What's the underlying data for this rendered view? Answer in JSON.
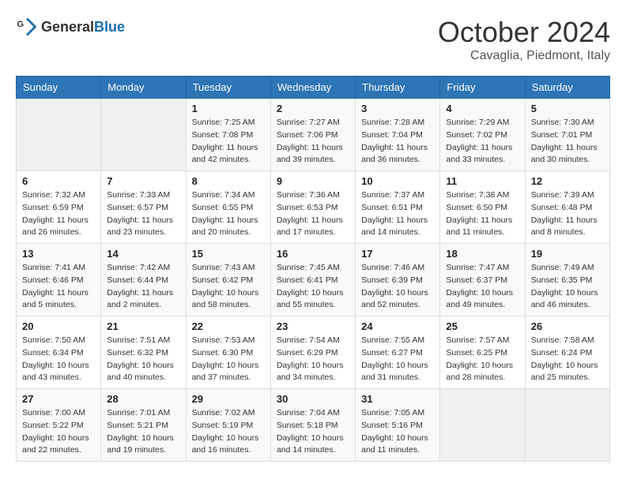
{
  "header": {
    "logo_general": "General",
    "logo_blue": "Blue",
    "title": "October 2024",
    "subtitle": "Cavaglia, Piedmont, Italy"
  },
  "weekdays": [
    "Sunday",
    "Monday",
    "Tuesday",
    "Wednesday",
    "Thursday",
    "Friday",
    "Saturday"
  ],
  "weeks": [
    [
      {
        "day": "",
        "sunrise": "",
        "sunset": "",
        "daylight": ""
      },
      {
        "day": "",
        "sunrise": "",
        "sunset": "",
        "daylight": ""
      },
      {
        "day": "1",
        "sunrise": "Sunrise: 7:25 AM",
        "sunset": "Sunset: 7:08 PM",
        "daylight": "Daylight: 11 hours and 42 minutes."
      },
      {
        "day": "2",
        "sunrise": "Sunrise: 7:27 AM",
        "sunset": "Sunset: 7:06 PM",
        "daylight": "Daylight: 11 hours and 39 minutes."
      },
      {
        "day": "3",
        "sunrise": "Sunrise: 7:28 AM",
        "sunset": "Sunset: 7:04 PM",
        "daylight": "Daylight: 11 hours and 36 minutes."
      },
      {
        "day": "4",
        "sunrise": "Sunrise: 7:29 AM",
        "sunset": "Sunset: 7:02 PM",
        "daylight": "Daylight: 11 hours and 33 minutes."
      },
      {
        "day": "5",
        "sunrise": "Sunrise: 7:30 AM",
        "sunset": "Sunset: 7:01 PM",
        "daylight": "Daylight: 11 hours and 30 minutes."
      }
    ],
    [
      {
        "day": "6",
        "sunrise": "Sunrise: 7:32 AM",
        "sunset": "Sunset: 6:59 PM",
        "daylight": "Daylight: 11 hours and 26 minutes."
      },
      {
        "day": "7",
        "sunrise": "Sunrise: 7:33 AM",
        "sunset": "Sunset: 6:57 PM",
        "daylight": "Daylight: 11 hours and 23 minutes."
      },
      {
        "day": "8",
        "sunrise": "Sunrise: 7:34 AM",
        "sunset": "Sunset: 6:55 PM",
        "daylight": "Daylight: 11 hours and 20 minutes."
      },
      {
        "day": "9",
        "sunrise": "Sunrise: 7:36 AM",
        "sunset": "Sunset: 6:53 PM",
        "daylight": "Daylight: 11 hours and 17 minutes."
      },
      {
        "day": "10",
        "sunrise": "Sunrise: 7:37 AM",
        "sunset": "Sunset: 6:51 PM",
        "daylight": "Daylight: 11 hours and 14 minutes."
      },
      {
        "day": "11",
        "sunrise": "Sunrise: 7:38 AM",
        "sunset": "Sunset: 6:50 PM",
        "daylight": "Daylight: 11 hours and 11 minutes."
      },
      {
        "day": "12",
        "sunrise": "Sunrise: 7:39 AM",
        "sunset": "Sunset: 6:48 PM",
        "daylight": "Daylight: 11 hours and 8 minutes."
      }
    ],
    [
      {
        "day": "13",
        "sunrise": "Sunrise: 7:41 AM",
        "sunset": "Sunset: 6:46 PM",
        "daylight": "Daylight: 11 hours and 5 minutes."
      },
      {
        "day": "14",
        "sunrise": "Sunrise: 7:42 AM",
        "sunset": "Sunset: 6:44 PM",
        "daylight": "Daylight: 11 hours and 2 minutes."
      },
      {
        "day": "15",
        "sunrise": "Sunrise: 7:43 AM",
        "sunset": "Sunset: 6:42 PM",
        "daylight": "Daylight: 10 hours and 58 minutes."
      },
      {
        "day": "16",
        "sunrise": "Sunrise: 7:45 AM",
        "sunset": "Sunset: 6:41 PM",
        "daylight": "Daylight: 10 hours and 55 minutes."
      },
      {
        "day": "17",
        "sunrise": "Sunrise: 7:46 AM",
        "sunset": "Sunset: 6:39 PM",
        "daylight": "Daylight: 10 hours and 52 minutes."
      },
      {
        "day": "18",
        "sunrise": "Sunrise: 7:47 AM",
        "sunset": "Sunset: 6:37 PM",
        "daylight": "Daylight: 10 hours and 49 minutes."
      },
      {
        "day": "19",
        "sunrise": "Sunrise: 7:49 AM",
        "sunset": "Sunset: 6:35 PM",
        "daylight": "Daylight: 10 hours and 46 minutes."
      }
    ],
    [
      {
        "day": "20",
        "sunrise": "Sunrise: 7:50 AM",
        "sunset": "Sunset: 6:34 PM",
        "daylight": "Daylight: 10 hours and 43 minutes."
      },
      {
        "day": "21",
        "sunrise": "Sunrise: 7:51 AM",
        "sunset": "Sunset: 6:32 PM",
        "daylight": "Daylight: 10 hours and 40 minutes."
      },
      {
        "day": "22",
        "sunrise": "Sunrise: 7:53 AM",
        "sunset": "Sunset: 6:30 PM",
        "daylight": "Daylight: 10 hours and 37 minutes."
      },
      {
        "day": "23",
        "sunrise": "Sunrise: 7:54 AM",
        "sunset": "Sunset: 6:29 PM",
        "daylight": "Daylight: 10 hours and 34 minutes."
      },
      {
        "day": "24",
        "sunrise": "Sunrise: 7:55 AM",
        "sunset": "Sunset: 6:27 PM",
        "daylight": "Daylight: 10 hours and 31 minutes."
      },
      {
        "day": "25",
        "sunrise": "Sunrise: 7:57 AM",
        "sunset": "Sunset: 6:25 PM",
        "daylight": "Daylight: 10 hours and 28 minutes."
      },
      {
        "day": "26",
        "sunrise": "Sunrise: 7:58 AM",
        "sunset": "Sunset: 6:24 PM",
        "daylight": "Daylight: 10 hours and 25 minutes."
      }
    ],
    [
      {
        "day": "27",
        "sunrise": "Sunrise: 7:00 AM",
        "sunset": "Sunset: 5:22 PM",
        "daylight": "Daylight: 10 hours and 22 minutes."
      },
      {
        "day": "28",
        "sunrise": "Sunrise: 7:01 AM",
        "sunset": "Sunset: 5:21 PM",
        "daylight": "Daylight: 10 hours and 19 minutes."
      },
      {
        "day": "29",
        "sunrise": "Sunrise: 7:02 AM",
        "sunset": "Sunset: 5:19 PM",
        "daylight": "Daylight: 10 hours and 16 minutes."
      },
      {
        "day": "30",
        "sunrise": "Sunrise: 7:04 AM",
        "sunset": "Sunset: 5:18 PM",
        "daylight": "Daylight: 10 hours and 14 minutes."
      },
      {
        "day": "31",
        "sunrise": "Sunrise: 7:05 AM",
        "sunset": "Sunset: 5:16 PM",
        "daylight": "Daylight: 10 hours and 11 minutes."
      },
      {
        "day": "",
        "sunrise": "",
        "sunset": "",
        "daylight": ""
      },
      {
        "day": "",
        "sunrise": "",
        "sunset": "",
        "daylight": ""
      }
    ]
  ]
}
